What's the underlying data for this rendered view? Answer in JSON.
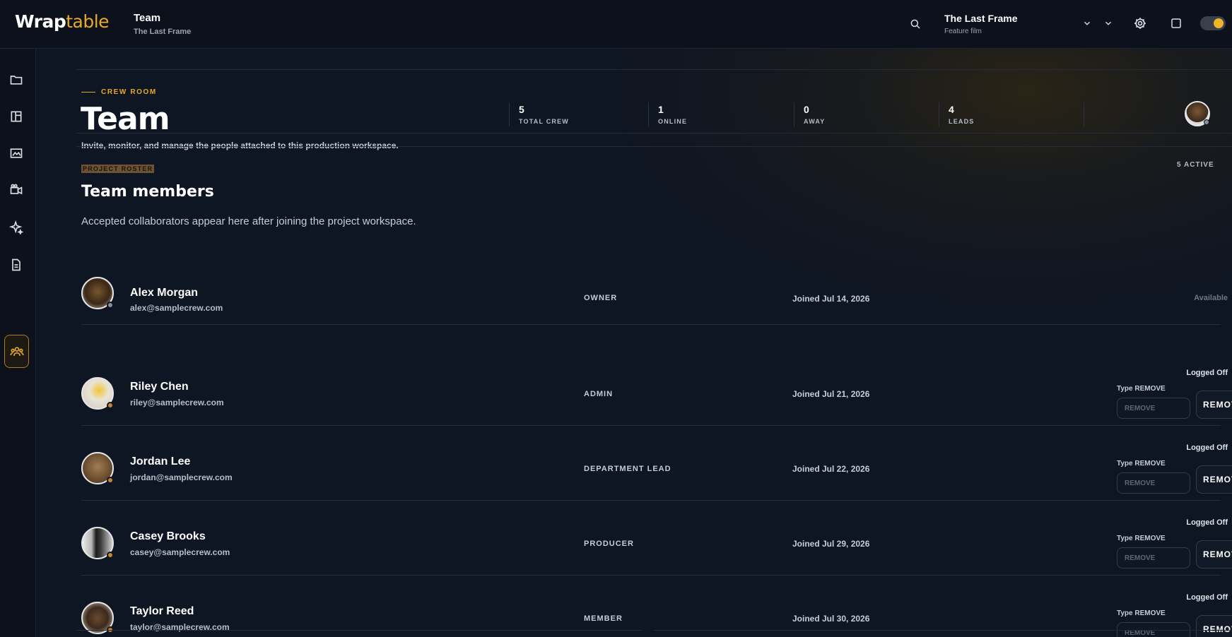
{
  "header": {
    "logo_primary": "Wrap",
    "logo_secondary": "table",
    "breadcrumb_title": "Team",
    "breadcrumb_sub": "The Last Frame",
    "project_name": "The Last Frame",
    "project_type": "Feature film",
    "icons": [
      "search-icon",
      "chevron-down-icon",
      "gear-icon",
      "square-icon",
      "theme-toggle"
    ]
  },
  "sidebar": {
    "items": [
      {
        "icon": "folder-icon",
        "active": false
      },
      {
        "icon": "board-icon",
        "active": false
      },
      {
        "icon": "image-icon",
        "active": false
      },
      {
        "icon": "camera-icon",
        "active": false
      },
      {
        "icon": "sparkle-icon",
        "active": false
      },
      {
        "icon": "document-icon",
        "active": false
      },
      {
        "icon": "team-icon",
        "active": true
      }
    ]
  },
  "hero": {
    "eyebrow": "CREW ROOM",
    "title": "Team",
    "description": "Invite, monitor, and manage the people attached to this production workspace.",
    "stats": [
      {
        "value": "5",
        "label": "TOTAL CREW"
      },
      {
        "value": "1",
        "label": "ONLINE"
      },
      {
        "value": "0",
        "label": "AWAY"
      },
      {
        "value": "4",
        "label": "LEADS"
      }
    ]
  },
  "roster": {
    "tag": "PROJECT ROSTER",
    "count": "5 ACTIVE",
    "title": "Team members",
    "description": "Accepted collaborators appear here after joining the project workspace.",
    "members": [
      {
        "name": "Alex Morgan",
        "email": "alex@samplecrew.com",
        "role": "OWNER",
        "joined": "Joined Jul 14, 2026",
        "status": "Available",
        "removable": false
      },
      {
        "name": "Riley Chen",
        "email": "riley@samplecrew.com",
        "role": "ADMIN",
        "joined": "Joined Jul 21, 2026",
        "status": "Logged Off",
        "removable": true,
        "type_label": "Type REMOVE",
        "placeholder": "REMOVE",
        "button": "REMOVE"
      },
      {
        "name": "Jordan Lee",
        "email": "jordan@samplecrew.com",
        "role": "DEPARTMENT LEAD",
        "joined": "Joined Jul 22, 2026",
        "status": "Logged Off",
        "removable": true,
        "type_label": "Type REMOVE",
        "placeholder": "REMOVE",
        "button": "REMOVE"
      },
      {
        "name": "Casey Brooks",
        "email": "casey@samplecrew.com",
        "role": "PRODUCER",
        "joined": "Joined Jul 29, 2026",
        "status": "Logged Off",
        "removable": true,
        "type_label": "Type REMOVE",
        "placeholder": "REMOVE",
        "button": "REMOVE"
      },
      {
        "name": "Taylor Reed",
        "email": "taylor@samplecrew.com",
        "role": "MEMBER",
        "joined": "Joined Jul 30, 2026",
        "status": "Logged Off",
        "removable": true,
        "type_label": "Type REMOVE",
        "placeholder": "REMOVE",
        "button": "REMOVE"
      }
    ]
  },
  "colors": {
    "accent": "#e8a92a",
    "background": "#0e1523",
    "status_away": "#c9852b"
  }
}
